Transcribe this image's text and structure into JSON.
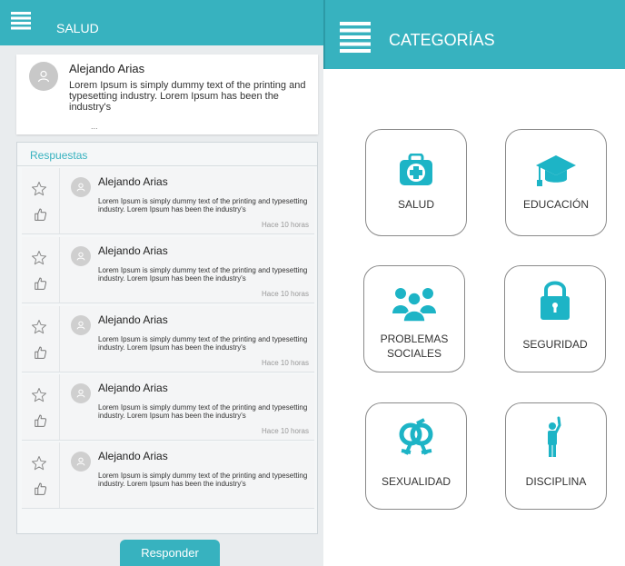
{
  "left": {
    "title": "SALUD",
    "post": {
      "author": "Alejando Arias",
      "text": "Lorem Ipsum is simply dummy text of the printing and typesetting industry. Lorem Ipsum has been the industry's",
      "more": "..."
    },
    "answers_title": "Respuestas",
    "answers": [
      {
        "author": "Alejando Arias",
        "text": "Lorem Ipsum is simply dummy text of the printing and typesetting industry. Lorem Ipsum has been the industry's",
        "time": "Hace 10 horas"
      },
      {
        "author": "Alejando Arias",
        "text": "Lorem Ipsum is simply dummy text of the printing and typesetting industry. Lorem Ipsum has been the industry's",
        "time": "Hace 10 horas"
      },
      {
        "author": "Alejando Arias",
        "text": "Lorem Ipsum is simply dummy text of the printing and typesetting industry. Lorem Ipsum has been the industry's",
        "time": "Hace 10 horas"
      },
      {
        "author": "Alejando Arias",
        "text": "Lorem Ipsum is simply dummy text of the printing and typesetting industry. Lorem Ipsum has been the industry's",
        "time": "Hace 10 horas"
      },
      {
        "author": "Alejando Arias",
        "text": "Lorem Ipsum is simply dummy text of the printing and typesetting industry. Lorem Ipsum has been the industry's",
        "time": ""
      }
    ],
    "reply_label": "Responder"
  },
  "right": {
    "title": "CATEGORÍAS",
    "categories": [
      {
        "label": "SALUD",
        "icon": "medical-kit-icon"
      },
      {
        "label": "EDUCACIÓN",
        "icon": "graduation-cap-icon"
      },
      {
        "label": "PROBLEMAS SOCIALES",
        "icon": "people-group-icon"
      },
      {
        "label": "SEGURIDAD",
        "icon": "padlock-icon"
      },
      {
        "label": "SEXUALIDAD",
        "icon": "gender-symbols-icon"
      },
      {
        "label": "DISCIPLINA",
        "icon": "raised-hand-person-icon"
      }
    ]
  },
  "colors": {
    "accent": "#37b2bf",
    "panel_bg": "#e9ecee"
  }
}
